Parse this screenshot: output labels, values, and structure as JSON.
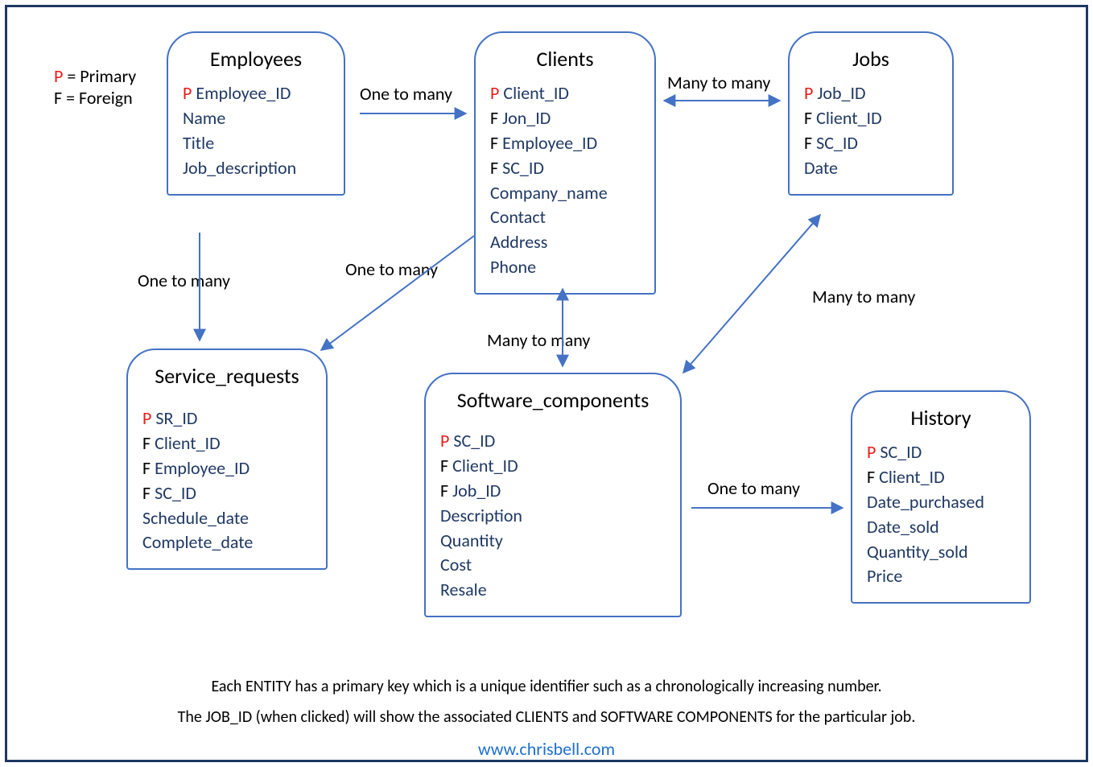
{
  "legend": {
    "p_label": "P",
    "p_text": " = Primary",
    "f_label": "F",
    "f_text": " = Foreign"
  },
  "entities": {
    "employees": {
      "title": "Employees",
      "attrs": [
        {
          "key": "P",
          "name": "Employee_ID"
        },
        {
          "key": "",
          "name": "Name"
        },
        {
          "key": "",
          "name": "Title"
        },
        {
          "key": "",
          "name": "Job_description"
        }
      ]
    },
    "clients": {
      "title": "Clients",
      "attrs": [
        {
          "key": "P",
          "name": "Client_ID"
        },
        {
          "key": "F",
          "name": "Jon_ID"
        },
        {
          "key": "F",
          "name": "Employee_ID"
        },
        {
          "key": "F",
          "name": "SC_ID"
        },
        {
          "key": "",
          "name": "Company_name"
        },
        {
          "key": "",
          "name": "Contact"
        },
        {
          "key": "",
          "name": "Address"
        },
        {
          "key": "",
          "name": "Phone"
        }
      ]
    },
    "jobs": {
      "title": "Jobs",
      "attrs": [
        {
          "key": "P",
          "name": "Job_ID"
        },
        {
          "key": "F",
          "name": "Client_ID"
        },
        {
          "key": "F",
          "name": "SC_ID"
        },
        {
          "key": "",
          "name": "Date"
        }
      ]
    },
    "service_requests": {
      "title": "Service_requests",
      "attrs": [
        {
          "key": "P",
          "name": "SR_ID"
        },
        {
          "key": "F",
          "name": "Client_ID"
        },
        {
          "key": "F",
          "name": "Employee_ID"
        },
        {
          "key": "F",
          "name": "SC_ID"
        },
        {
          "key": "",
          "name": "Schedule_date"
        },
        {
          "key": "",
          "name": "Complete_date"
        }
      ]
    },
    "software_components": {
      "title": "Software_components",
      "attrs": [
        {
          "key": "P",
          "name": "SC_ID"
        },
        {
          "key": "F",
          "name": "Client_ID"
        },
        {
          "key": "F",
          "name": "Job_ID"
        },
        {
          "key": "",
          "name": "Description"
        },
        {
          "key": "",
          "name": "Quantity"
        },
        {
          "key": "",
          "name": "Cost"
        },
        {
          "key": "",
          "name": "Resale"
        }
      ]
    },
    "history": {
      "title": "History",
      "attrs": [
        {
          "key": "P",
          "name": "SC_ID"
        },
        {
          "key": "F",
          "name": "Client_ID"
        },
        {
          "key": "",
          "name": "Date_purchased"
        },
        {
          "key": "",
          "name": "Date_sold"
        },
        {
          "key": "",
          "name": "Quantity_sold"
        },
        {
          "key": "",
          "name": "Price"
        }
      ]
    }
  },
  "relations": {
    "emp_clients": "One to many",
    "clients_jobs": "Many to many",
    "emp_sr": "One to many",
    "clients_sr": "One to many",
    "clients_sc": "Many to many",
    "jobs_sc": "Many to many",
    "sc_history": "One to many"
  },
  "captions": {
    "line1": "Each ENTITY has a primary key which is a unique identifier such as a chronologically increasing number.",
    "line2": "The JOB_ID (when clicked) will show the associated CLIENTS and SOFTWARE COMPONENTS for the particular job.",
    "link": "www.chrisbell.com"
  }
}
